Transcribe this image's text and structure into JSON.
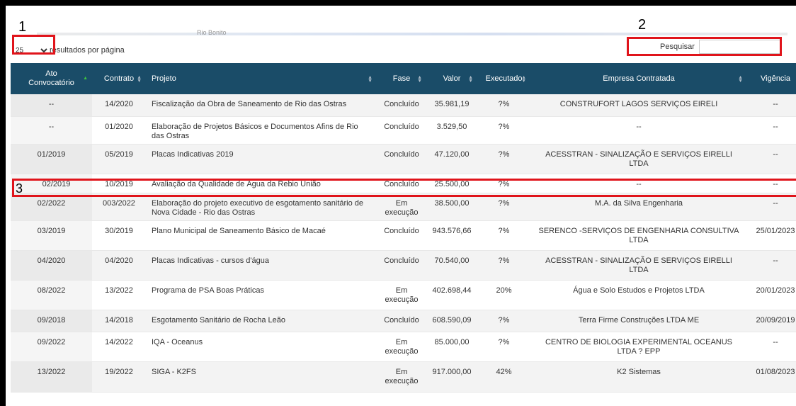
{
  "annotations": [
    "1",
    "2",
    "3"
  ],
  "strip_text": "Rio Bonito",
  "per_page": {
    "value": "25",
    "label": "resultados por página"
  },
  "search": {
    "label": "Pesquisar",
    "placeholder": ""
  },
  "columns": [
    "Ato Convocatório",
    "Contrato",
    "Projeto",
    "Fase",
    "Valor",
    "Executado",
    "Empresa Contratada",
    "Vigência"
  ],
  "rows": [
    [
      "--",
      "14/2020",
      "Fiscalização da Obra de Saneamento de Rio das Ostras",
      "Concluído",
      "35.981,19",
      "?%",
      "CONSTRUFORT LAGOS SERVIÇOS EIRELI",
      "--"
    ],
    [
      "--",
      "01/2020",
      "Elaboração de Projetos Básicos e Documentos Afins de Rio das Ostras",
      "Concluído",
      "3.529,50",
      "?%",
      "--",
      "--"
    ],
    [
      "01/2019",
      "05/2019",
      "Placas Indicativas 2019",
      "Concluído",
      "47.120,00",
      "?%",
      "ACESSTRAN - SINALIZAÇÃO E SERVIÇOS EIRELLI LTDA",
      "--"
    ],
    [
      "02/2019",
      "10/2019",
      "Avaliação da Qualidade de Água da Rebio União",
      "Concluído",
      "25.500,00",
      "?%",
      "--",
      "--"
    ],
    [
      "02/2022",
      "003/2022",
      "Elaboração do projeto executivo de esgotamento sanitário de Nova Cidade - Rio das Ostras",
      "Em execução",
      "38.500,00",
      "?%",
      "M.A. da Silva Engenharia",
      "--"
    ],
    [
      "03/2019",
      "30/2019",
      "Plano Municipal de Saneamento Básico de Macaé",
      "Concluído",
      "943.576,66",
      "?%",
      "SERENCO -SERVIÇOS DE ENGENHARIA CONSULTIVA LTDA",
      "25/01/2023"
    ],
    [
      "04/2020",
      "04/2020",
      "Placas Indicativas - cursos d'água",
      "Concluído",
      "70.540,00",
      "?%",
      "ACESSTRAN - SINALIZAÇÃO E SERVIÇOS EIRELLI LTDA",
      "--"
    ],
    [
      "08/2022",
      "13/2022",
      "Programa de PSA Boas Práticas",
      "Em execução",
      "402.698,44",
      "20%",
      "Água e Solo Estudos e Projetos LTDA",
      "20/01/2023"
    ],
    [
      "09/2018",
      "14/2018",
      "Esgotamento Sanitário de Rocha Leão",
      "Concluído",
      "608.590,09",
      "?%",
      "Terra Firme Construções LTDA ME",
      "20/09/2019"
    ],
    [
      "09/2022",
      "14/2022",
      "IQA - Oceanus",
      "Em execução",
      "85.000,00",
      "?%",
      "CENTRO DE BIOLOGIA EXPERIMENTAL OCEANUS LTDA ? EPP",
      "--"
    ],
    [
      "13/2022",
      "19/2022",
      "SIGA - K2FS",
      "Em execução",
      "917.000,00",
      "42%",
      "K2 Sistemas",
      "01/08/2023"
    ]
  ]
}
